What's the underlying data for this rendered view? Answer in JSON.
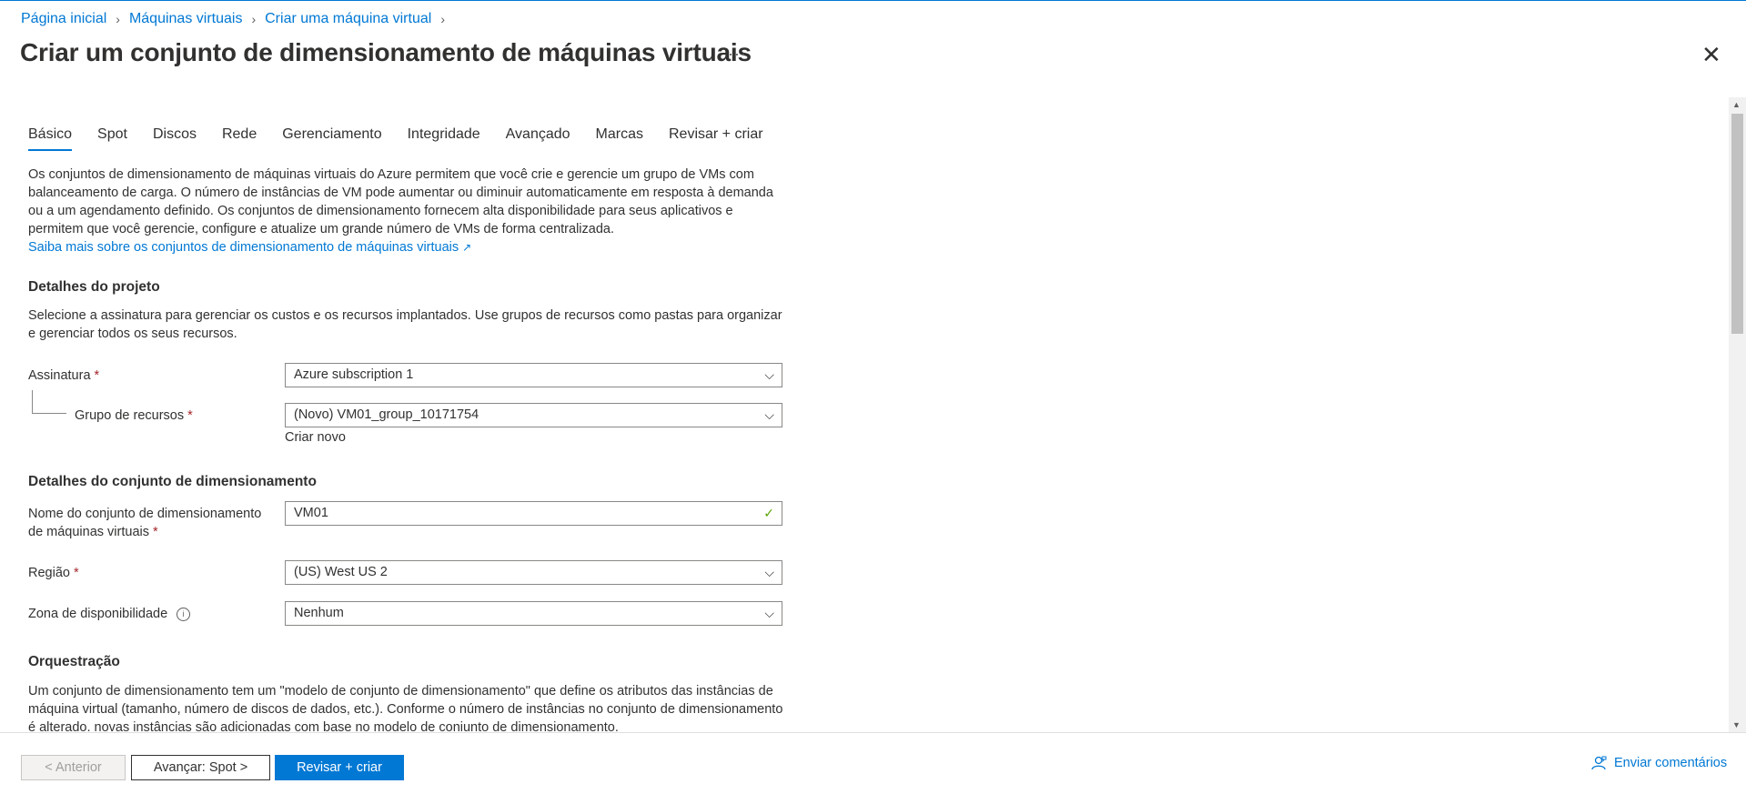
{
  "breadcrumb": {
    "items": [
      "Página inicial",
      "Máquinas virtuais",
      "Criar uma máquina virtual"
    ]
  },
  "page": {
    "title": "Criar um conjunto de dimensionamento de máquinas virtuais",
    "more": "···",
    "close": "✕"
  },
  "tabs": [
    "Básico",
    "Spot",
    "Discos",
    "Rede",
    "Gerenciamento",
    "Integridade",
    "Avançado",
    "Marcas",
    "Revisar + criar"
  ],
  "intro": {
    "text": "Os conjuntos de dimensionamento de máquinas virtuais do Azure permitem que você crie e gerencie um grupo de VMs com balanceamento de carga. O número de instâncias de VM pode aumentar ou diminuir automaticamente em resposta à demanda ou a um agendamento definido. Os conjuntos de dimensionamento fornecem alta disponibilidade para seus aplicativos e permitem que você gerencie, configure e atualize um grande número de VMs de forma centralizada.",
    "link": "Saiba mais sobre os conjuntos de dimensionamento de máquinas virtuais",
    "link_icon": "external-link-icon"
  },
  "project": {
    "heading": "Detalhes do projeto",
    "description": "Selecione a assinatura para gerenciar os custos e os recursos implantados. Use grupos de recursos como pastas para organizar e gerenciar todos os seus recursos.",
    "subscription_label": "Assinatura",
    "subscription_value": "Azure subscription 1",
    "resource_group_label": "Grupo de recursos",
    "resource_group_value": "(Novo) VM01_group_10171754",
    "create_new": "Criar novo"
  },
  "scale_set": {
    "heading": "Detalhes do conjunto de dimensionamento",
    "name_label_line1": "Nome do conjunto de dimensionamento",
    "name_label_line2": "de máquinas virtuais",
    "name_value": "VM01",
    "region_label": "Região",
    "region_value": "(US) West US 2",
    "zone_label": "Zona de disponibilidade",
    "zone_value": "Nenhum"
  },
  "orchestration": {
    "heading": "Orquestração",
    "text": "Um conjunto de dimensionamento tem um \"modelo de conjunto de dimensionamento\" que define os atributos das instâncias de máquina virtual (tamanho, número de discos de dados, etc.). Conforme o número de instâncias no conjunto de dimensionamento é alterado, novas instâncias são adicionadas com base no modelo de conjunto de dimensionamento."
  },
  "required_marker": "*",
  "footer": {
    "prev": "< Anterior",
    "next": "Avançar: Spot >",
    "review": "Revisar + criar",
    "feedback": "Enviar comentários"
  },
  "colors": {
    "accent": "#0078d4",
    "required": "#a4262c",
    "valid": "#57a300"
  }
}
